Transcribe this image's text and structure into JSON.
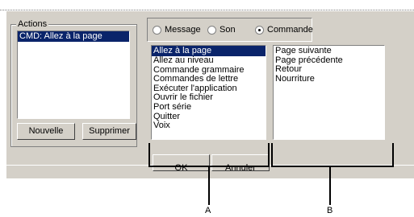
{
  "actions_group": {
    "title": "Actions",
    "items": [
      "CMD: Allez à la page"
    ],
    "new_button": "Nouvelle",
    "delete_button": "Supprimer"
  },
  "mode": {
    "options": [
      "Message",
      "Son",
      "Commande"
    ],
    "selected": "Commande"
  },
  "commands_list": {
    "items": [
      "Allez à la page",
      "Allez au niveau",
      "Commande grammaire",
      "Commandes de lettre",
      "Exécuter l'application",
      "Ouvrir le fichier",
      "Port série",
      "Quitter",
      "Voix"
    ],
    "selected_index": 0
  },
  "params_list": {
    "items": [
      "Page suivante",
      "Page précédente",
      "Retour",
      "Nourriture"
    ]
  },
  "bottom_buttons": {
    "ok": "OK",
    "cancel": "Annuler"
  },
  "callouts": {
    "a": "A",
    "b": "B"
  }
}
